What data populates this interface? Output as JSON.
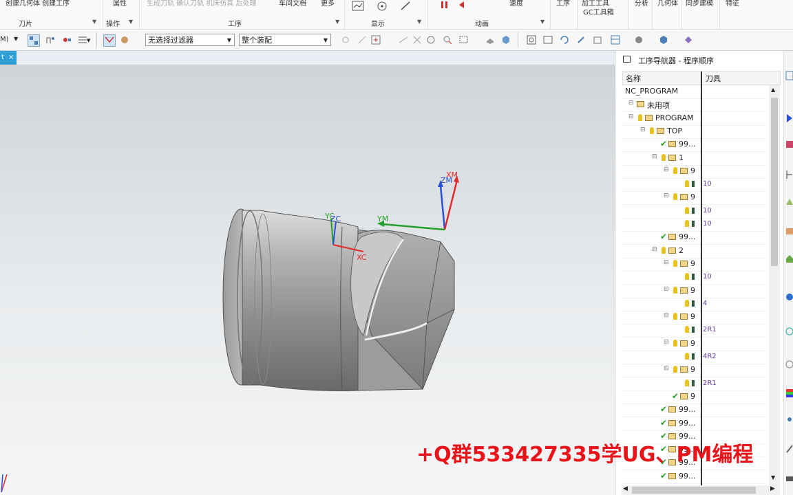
{
  "ribbon": {
    "top_labels": [
      {
        "text": "创建几何体  创建工序",
        "grey": false
      },
      {
        "text": "属性",
        "grey": false
      },
      {
        "text": "生成刀轨  确认刀轨  机床仿真  后处理",
        "grey": true
      },
      {
        "text": "车间文档",
        "grey": false
      },
      {
        "text": "更多",
        "grey": false
      },
      {
        "text": "速度",
        "grey": false
      },
      {
        "text": "工序",
        "grey": false
      },
      {
        "text": "加工工具",
        "grey": false
      },
      {
        "text": "分析",
        "grey": false
      },
      {
        "text": "几何体",
        "grey": false
      },
      {
        "text": "同步建模",
        "grey": false
      },
      {
        "text": "特征",
        "grey": false
      }
    ],
    "gc_label": "GC工具箱",
    "groups": [
      "刀片",
      "操作",
      "工序",
      "显示",
      "动画"
    ]
  },
  "toolbar": {
    "left_label": "M)",
    "filter_value": "无选择过滤器",
    "assembly_value": "整个装配"
  },
  "doc_tab": {
    "text": "t",
    "close": "×"
  },
  "viewport": {
    "axes": {
      "zm": "ZM",
      "xm": "XM",
      "ym": "YM",
      "yc": "YC",
      "zc": "ZC",
      "xc": "XC"
    }
  },
  "navigator": {
    "title": "工序导航器 - 程序顺序",
    "col_name": "名称",
    "col_tool": "刀具",
    "rows": [
      {
        "name": "NC_PROGRAM",
        "tool": "",
        "indent": 0,
        "check": false,
        "bulb": false,
        "folder": false
      },
      {
        "name": "未用项",
        "tool": "",
        "indent": 1,
        "check": false,
        "bulb": false,
        "folder": true
      },
      {
        "name": "PROGRAM",
        "tool": "",
        "indent": 1,
        "check": false,
        "bulb": true,
        "folder": true
      },
      {
        "name": "TOP",
        "tool": "",
        "indent": 2,
        "check": false,
        "bulb": true,
        "folder": true
      },
      {
        "name": "99...",
        "tool": "",
        "indent": 3,
        "check": true,
        "bulb": false,
        "folder": true
      },
      {
        "name": "1",
        "tool": "",
        "indent": 3,
        "check": false,
        "bulb": true,
        "folder": true
      },
      {
        "name": "9",
        "tool": "",
        "indent": 4,
        "check": false,
        "bulb": true,
        "folder": true
      },
      {
        "name": "",
        "tool": "10",
        "indent": 5,
        "check": false,
        "bulb": true,
        "folder": false
      },
      {
        "name": "9",
        "tool": "",
        "indent": 4,
        "check": false,
        "bulb": true,
        "folder": true
      },
      {
        "name": "",
        "tool": "10",
        "indent": 5,
        "check": false,
        "bulb": true,
        "folder": false
      },
      {
        "name": "",
        "tool": "10",
        "indent": 5,
        "check": false,
        "bulb": true,
        "folder": false
      },
      {
        "name": "99...",
        "tool": "",
        "indent": 3,
        "check": true,
        "bulb": false,
        "folder": true
      },
      {
        "name": "2",
        "tool": "",
        "indent": 3,
        "check": false,
        "bulb": true,
        "folder": true
      },
      {
        "name": "9",
        "tool": "",
        "indent": 4,
        "check": false,
        "bulb": true,
        "folder": true
      },
      {
        "name": "",
        "tool": "10",
        "indent": 5,
        "check": false,
        "bulb": true,
        "folder": false
      },
      {
        "name": "9",
        "tool": "",
        "indent": 4,
        "check": false,
        "bulb": true,
        "folder": true
      },
      {
        "name": "",
        "tool": "4",
        "indent": 5,
        "check": false,
        "bulb": true,
        "folder": false
      },
      {
        "name": "9",
        "tool": "",
        "indent": 4,
        "check": false,
        "bulb": true,
        "folder": true
      },
      {
        "name": "",
        "tool": "2R1",
        "indent": 5,
        "check": false,
        "bulb": true,
        "folder": false
      },
      {
        "name": "9",
        "tool": "",
        "indent": 4,
        "check": false,
        "bulb": true,
        "folder": true
      },
      {
        "name": "",
        "tool": "4R2",
        "indent": 5,
        "check": false,
        "bulb": true,
        "folder": false
      },
      {
        "name": "9",
        "tool": "",
        "indent": 4,
        "check": false,
        "bulb": true,
        "folder": true
      },
      {
        "name": "",
        "tool": "2R1",
        "indent": 5,
        "check": false,
        "bulb": true,
        "folder": false
      },
      {
        "name": "9",
        "tool": "",
        "indent": 4,
        "check": true,
        "bulb": false,
        "folder": true
      },
      {
        "name": "99...",
        "tool": "",
        "indent": 3,
        "check": true,
        "bulb": false,
        "folder": true
      },
      {
        "name": "99...",
        "tool": "",
        "indent": 3,
        "check": true,
        "bulb": false,
        "folder": true
      },
      {
        "name": "99...",
        "tool": "",
        "indent": 3,
        "check": true,
        "bulb": false,
        "folder": true
      },
      {
        "name": "99...",
        "tool": "",
        "indent": 3,
        "check": true,
        "bulb": false,
        "folder": true
      },
      {
        "name": "99...",
        "tool": "",
        "indent": 3,
        "check": true,
        "bulb": false,
        "folder": true
      },
      {
        "name": "99...",
        "tool": "",
        "indent": 3,
        "check": true,
        "bulb": false,
        "folder": true
      }
    ]
  },
  "watermark": "+Q群533427335学UG、PM编程",
  "colors": {
    "accent": "#2f9fd6",
    "watermark": "#e8141a",
    "tool_text": "#6a3fa0",
    "check": "#2aa02a",
    "bulb": "#e8c21a"
  }
}
